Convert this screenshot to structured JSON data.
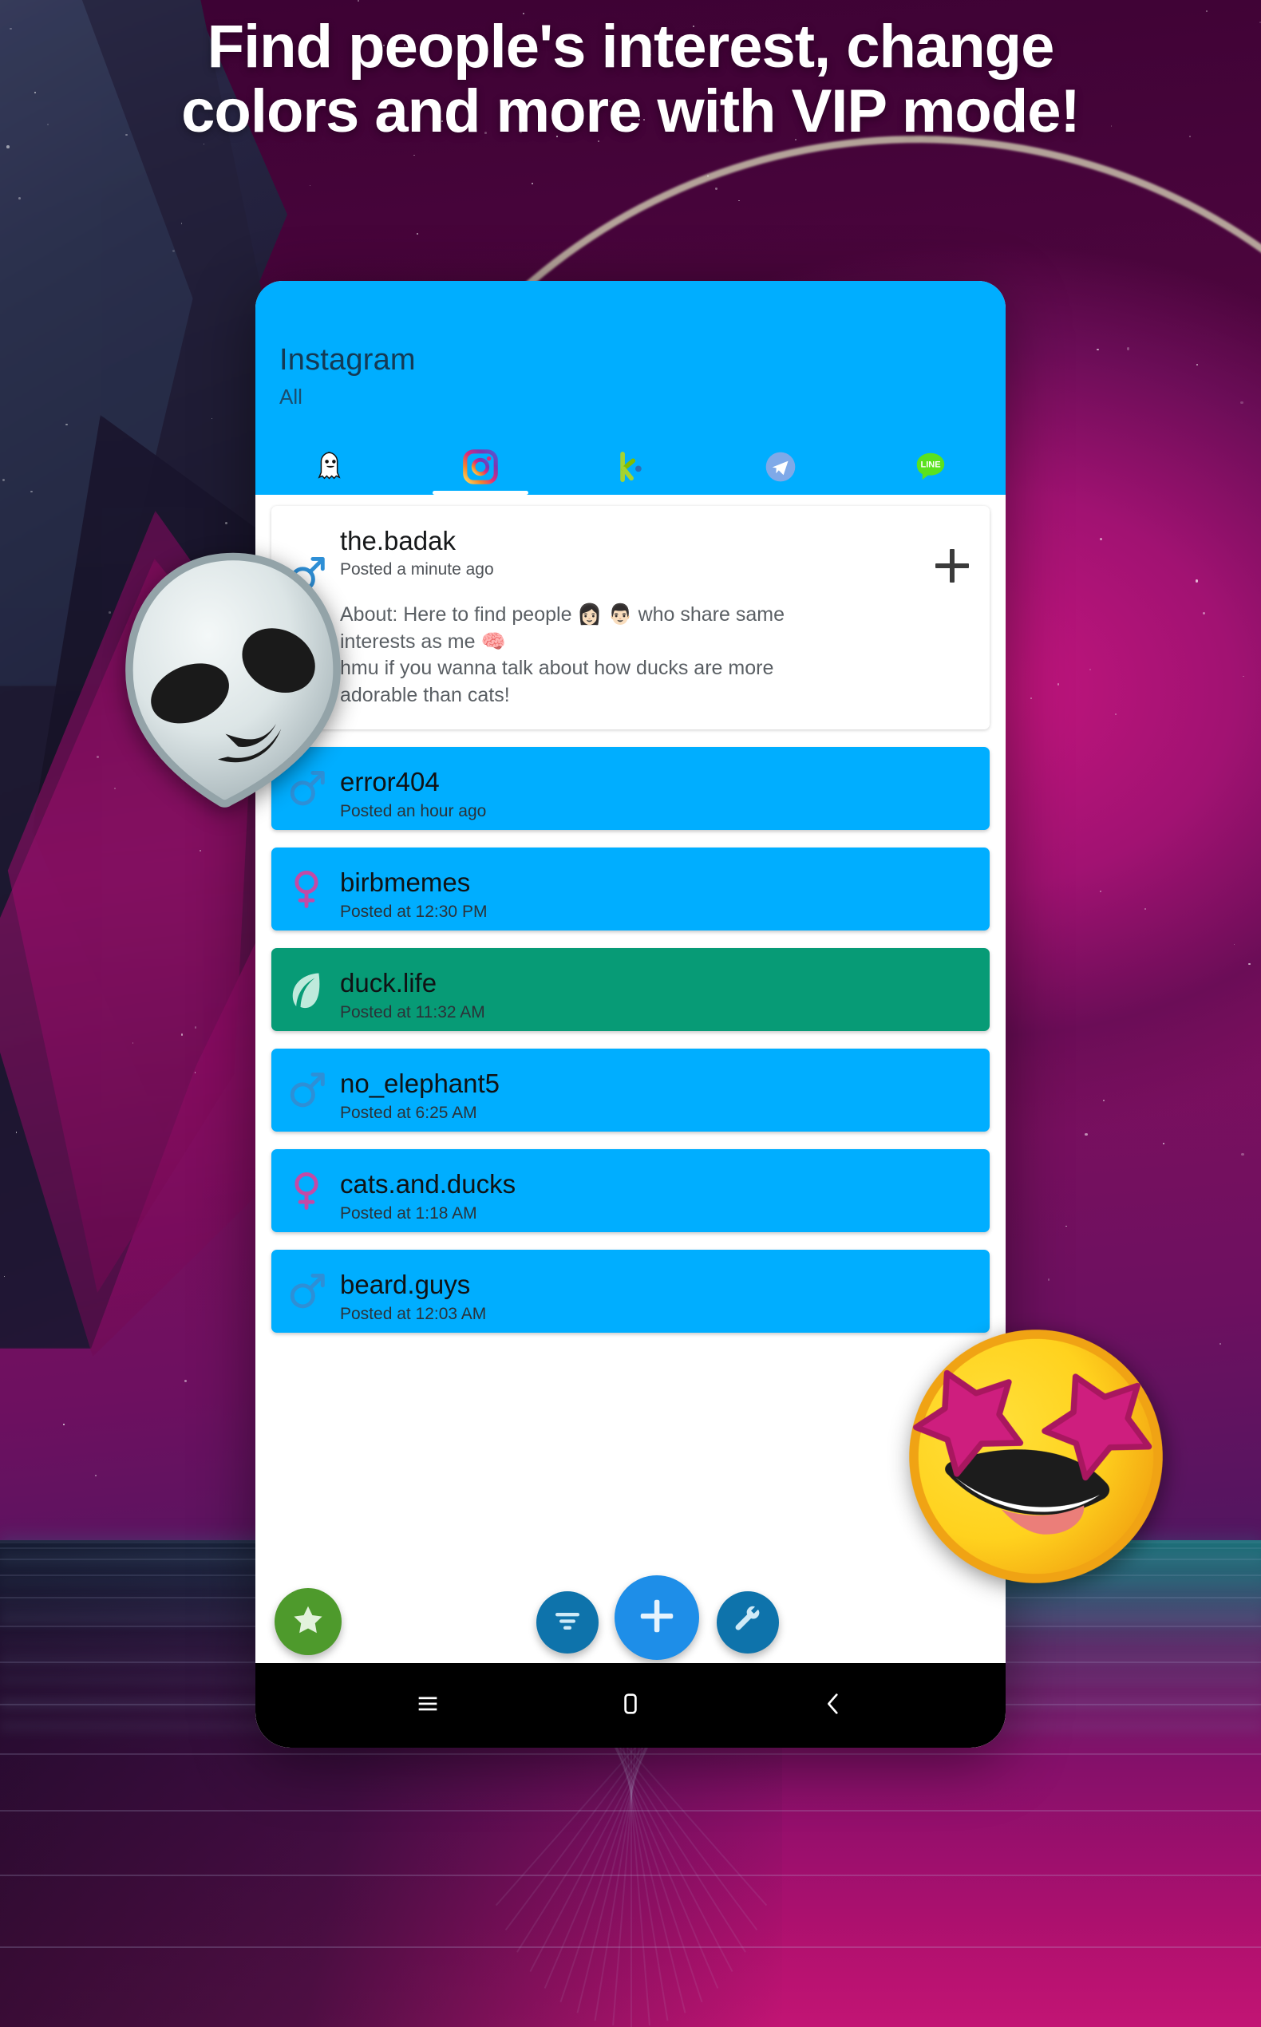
{
  "headline": {
    "line1": "Find people's interest, change",
    "line2": "colors and more with VIP mode!"
  },
  "colors": {
    "accent_blue": "#00AEFF",
    "row_blue": "#00AEFF",
    "row_green": "#079B76",
    "fab_green": "#4E9A2C",
    "fab_dark_blue": "#0E73AB",
    "fab_add_blue": "#1E8EE8",
    "male_icon": "#2E8FD6",
    "female_icon": "#C34AA6",
    "leaf_icon": "#BFEADC",
    "nav_bar": "#000000",
    "card_text": "#16181A"
  },
  "phone": {
    "header": {
      "title": "Instagram",
      "subtitle": "All"
    },
    "tabs": [
      {
        "id": "snapchat",
        "icon": "ghost-icon",
        "label": "Snapchat",
        "active": false
      },
      {
        "id": "instagram",
        "icon": "instagram-icon",
        "label": "Instagram",
        "active": true
      },
      {
        "id": "kik",
        "icon": "kik-icon",
        "label": "Kik",
        "active": false
      },
      {
        "id": "telegram",
        "icon": "telegram-icon",
        "label": "Telegram",
        "active": false
      },
      {
        "id": "line",
        "icon": "line-icon",
        "label": "LINE",
        "active": false
      }
    ],
    "featured_post": {
      "username": "the.badak",
      "posted": "Posted a minute ago",
      "gender_icon": "male-icon",
      "about_line1": "About: Here to find people 👩🏻 👨🏻 who share same",
      "about_line2": "interests as me 🧠",
      "about_line3": "hmu if you wanna talk about how ducks are more",
      "about_line4": "adorable than cats!",
      "add_button": "add-icon"
    },
    "posts": [
      {
        "username": "error404",
        "posted": "Posted an hour ago",
        "gender_icon": "male-icon",
        "color": "#00AEFF"
      },
      {
        "username": "birbmemes",
        "posted": "Posted at 12:30 PM",
        "gender_icon": "female-icon",
        "color": "#00AEFF"
      },
      {
        "username": "duck.life",
        "posted": "Posted at 11:32 AM",
        "gender_icon": "leaf-icon",
        "color": "#079B76"
      },
      {
        "username": "no_elephant5",
        "posted": "Posted at 6:25 AM",
        "gender_icon": "male-icon",
        "color": "#00AEFF"
      },
      {
        "username": "cats.and.ducks",
        "posted": "Posted at 1:18 AM",
        "gender_icon": "female-icon",
        "color": "#00AEFF"
      },
      {
        "username": "beard.guys",
        "posted": "Posted at 12:03 AM",
        "gender_icon": "male-icon",
        "color": "#00AEFF"
      }
    ],
    "fabs": [
      {
        "id": "favorites",
        "icon": "star-icon",
        "label": "Favorites"
      },
      {
        "id": "filter",
        "icon": "filter-icon",
        "label": "Filter"
      },
      {
        "id": "add",
        "icon": "plus-icon",
        "label": "Add"
      },
      {
        "id": "settings",
        "icon": "wrench-icon",
        "label": "Settings"
      }
    ],
    "nav": [
      {
        "id": "recents",
        "icon": "menu-icon",
        "label": "Recents"
      },
      {
        "id": "home",
        "icon": "home-icon",
        "label": "Home"
      },
      {
        "id": "back",
        "icon": "chevron-left-icon",
        "label": "Back"
      }
    ]
  },
  "overlays": [
    {
      "id": "alien",
      "icon": "alien-emoji",
      "glyph": "👽"
    },
    {
      "id": "star-struck",
      "icon": "star-struck-emoji",
      "glyph": "🤩"
    }
  ]
}
